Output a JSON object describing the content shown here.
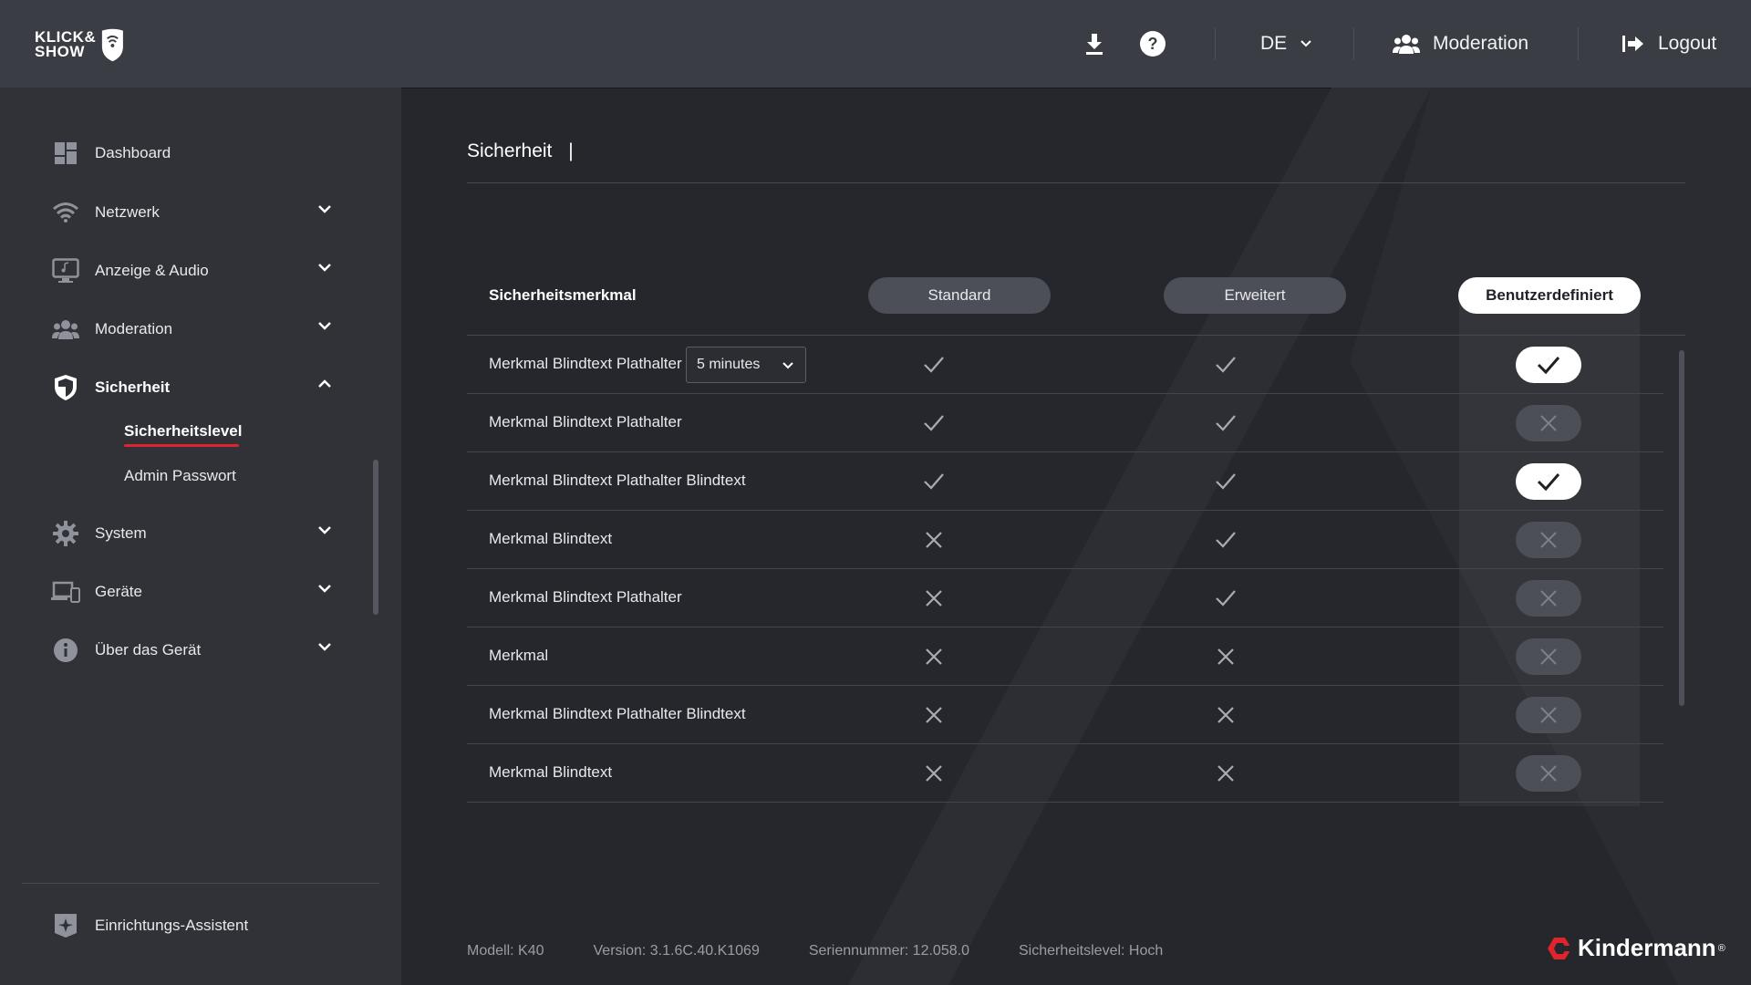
{
  "app": {
    "logo_line1": "KLICK&",
    "logo_line2": "SHOW",
    "brand": "Kindermann",
    "brand_mark": "®"
  },
  "header": {
    "download_icon": "download-icon",
    "help_icon": "help-icon",
    "language": "DE",
    "moderation_label": "Moderation",
    "logout_label": "Logout"
  },
  "sidebar": {
    "items": [
      {
        "label": "Dashboard",
        "icon": "dashboard-icon"
      },
      {
        "label": "Netzwerk",
        "icon": "wifi-icon"
      },
      {
        "label": "Anzeige & Audio",
        "icon": "monitor-icon"
      },
      {
        "label": "Moderation",
        "icon": "users-icon"
      },
      {
        "label": "Sicherheit",
        "icon": "shield-icon"
      },
      {
        "label": "System",
        "icon": "gear-icon"
      },
      {
        "label": "Geräte",
        "icon": "devices-icon"
      },
      {
        "label": "Über das Gerät",
        "icon": "info-icon"
      }
    ],
    "sub_items": [
      {
        "label": "Sicherheitslevel"
      },
      {
        "label": "Admin Passwort"
      }
    ],
    "setup_assistant": "Einrichtungs-Assistent"
  },
  "main": {
    "title": "Sicherheit",
    "title_cursor": "|",
    "column_header": "Sicherheitsmerkmal",
    "levels": [
      "Standard",
      "Erweitert",
      "Benutzerdefiniert"
    ],
    "active_level": "Benutzerdefiniert",
    "timeout_value": "5 minutes",
    "rows": [
      {
        "label": "Merkmal Blindtext Plathalter",
        "standard": true,
        "erweitert": true,
        "custom": true,
        "has_select": true
      },
      {
        "label": "Merkmal Blindtext Plathalter",
        "standard": true,
        "erweitert": true,
        "custom": false
      },
      {
        "label": "Merkmal Blindtext Plathalter Blindtext",
        "standard": true,
        "erweitert": true,
        "custom": true
      },
      {
        "label": "Merkmal Blindtext",
        "standard": false,
        "erweitert": true,
        "custom": false
      },
      {
        "label": "Merkmal Blindtext Plathalter",
        "standard": false,
        "erweitert": true,
        "custom": false
      },
      {
        "label": "Merkmal",
        "standard": false,
        "erweitert": false,
        "custom": false
      },
      {
        "label": "Merkmal Blindtext Plathalter Blindtext",
        "standard": false,
        "erweitert": false,
        "custom": false
      },
      {
        "label": "Merkmal Blindtext",
        "standard": false,
        "erweitert": false,
        "custom": false
      }
    ]
  },
  "footer": {
    "model": "Modell: K40",
    "version": "Version: 3.1.6C.40.K1069",
    "serial": "Seriennummer: 12.058.0",
    "security_level": "Sicherheitslevel: Hoch"
  },
  "colors": {
    "accent": "#e0242e",
    "header_bg": "#3a3d44",
    "sidebar_bg": "#303238",
    "main_bg": "#25272d"
  }
}
